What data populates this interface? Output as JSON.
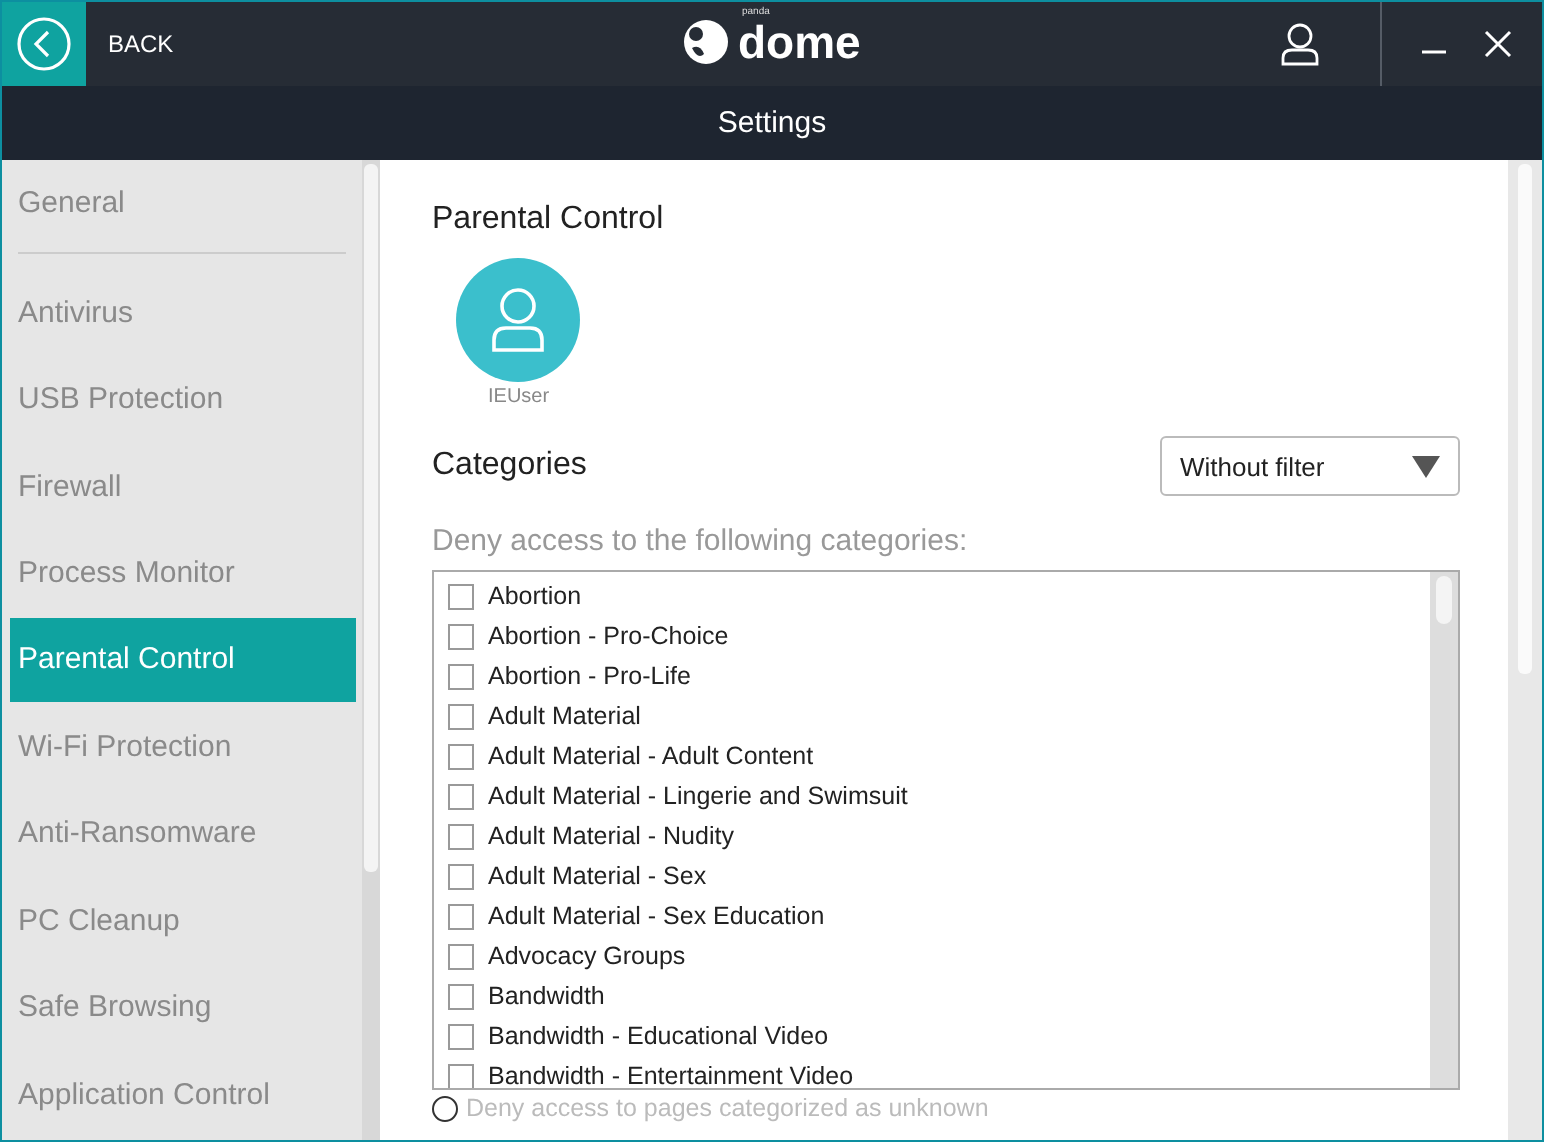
{
  "header": {
    "back_label": "BACK",
    "logo_small": "panda",
    "logo_name": "dome"
  },
  "title": "Settings",
  "sidebar": {
    "items": [
      {
        "label": "General",
        "selected": false
      },
      {
        "label": "Antivirus",
        "selected": false
      },
      {
        "label": "USB Protection",
        "selected": false
      },
      {
        "label": "Firewall",
        "selected": false
      },
      {
        "label": "Process Monitor",
        "selected": false
      },
      {
        "label": "Parental Control",
        "selected": true
      },
      {
        "label": "Wi-Fi Protection",
        "selected": false
      },
      {
        "label": "Anti-Ransomware",
        "selected": false
      },
      {
        "label": "PC Cleanup",
        "selected": false
      },
      {
        "label": "Safe Browsing",
        "selected": false
      },
      {
        "label": "Application Control",
        "selected": false
      }
    ]
  },
  "main": {
    "heading": "Parental Control",
    "user": {
      "name": "IEUser"
    },
    "categories_heading": "Categories",
    "filter": {
      "value": "Without filter"
    },
    "deny_label": "Deny access to the following categories:",
    "categories": [
      {
        "label": "Abortion",
        "checked": false
      },
      {
        "label": "Abortion - Pro-Choice",
        "checked": false
      },
      {
        "label": "Abortion - Pro-Life",
        "checked": false
      },
      {
        "label": "Adult Material",
        "checked": false
      },
      {
        "label": "Adult Material - Adult Content",
        "checked": false
      },
      {
        "label": "Adult Material - Lingerie and Swimsuit",
        "checked": false
      },
      {
        "label": "Adult Material - Nudity",
        "checked": false
      },
      {
        "label": "Adult Material - Sex",
        "checked": false
      },
      {
        "label": "Adult Material - Sex Education",
        "checked": false
      },
      {
        "label": "Advocacy Groups",
        "checked": false
      },
      {
        "label": "Bandwidth",
        "checked": false
      },
      {
        "label": "Bandwidth - Educational Video",
        "checked": false
      },
      {
        "label": "Bandwidth - Entertainment Video",
        "checked": false
      }
    ],
    "unknown_option": {
      "label": "Deny access to pages categorized as unknown",
      "selected": false
    }
  }
}
